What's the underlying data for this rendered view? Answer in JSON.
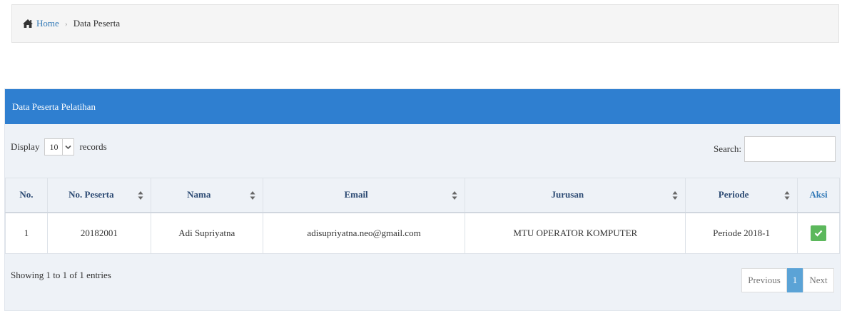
{
  "breadcrumb": {
    "home": "Home",
    "current": "Data Peserta"
  },
  "panel": {
    "title": "Data Peserta Pelatihan",
    "display_label": "Display",
    "display_value": "10",
    "records_label": "records",
    "search_label": "Search:"
  },
  "table": {
    "columns": [
      "No.",
      "No. Peserta",
      "Nama",
      "Email",
      "Jurusan",
      "Periode",
      "Aksi"
    ],
    "rows": [
      {
        "no": "1",
        "no_peserta": "20182001",
        "nama": "Adi Supriyatna",
        "email": "adisupriyatna.neo@gmail.com",
        "jurusan": "MTU OPERATOR KOMPUTER",
        "periode": "Periode 2018-1"
      }
    ]
  },
  "footer": {
    "info": "Showing 1 to 1 of 1 entries",
    "previous": "Previous",
    "page": "1",
    "next": "Next"
  },
  "colors": {
    "header": "#2f7fd0",
    "link": "#337ab7",
    "success": "#5cb85c",
    "active_page": "#5ba3d6"
  }
}
